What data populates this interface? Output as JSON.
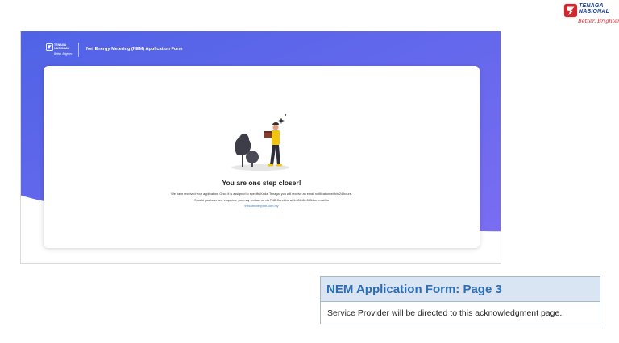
{
  "corner_logo": {
    "brand_line1": "TENAGA",
    "brand_line2": "NASIONAL",
    "tagline": "Better. Brighter.",
    "colors": {
      "blue": "#1b3f8f",
      "red": "#d4262b"
    }
  },
  "app": {
    "logo_line1": "TENAGA",
    "logo_line2": "NASIONAL",
    "logo_tagline": "Better. Brighter.",
    "title": "Net Energy Metering (NEM) Application Form",
    "gradient_colors": [
      "#4f63e6",
      "#7a6df2"
    ]
  },
  "confirmation": {
    "illustration_icon": "person-holding-box-illustration",
    "headline": "You are one step closer!",
    "message_line1": "We have received your application. Once it is assigned to specific Kedai Tenaga, you will receive an email notification within 24 hours.",
    "message_line2": "Should you have any enquiries, you may contact us via TNB CareLine at 1-300-88-5454 or email to",
    "email": "tnbcareline@tnb.com.my"
  },
  "panel": {
    "title": "NEM Application Form: Page 3",
    "description": "Service Provider will be directed to this acknowledgment page.",
    "colors": {
      "header_bg": "#d9e5f3",
      "title": "#2d6db3",
      "border": "#a9b8c9"
    }
  }
}
